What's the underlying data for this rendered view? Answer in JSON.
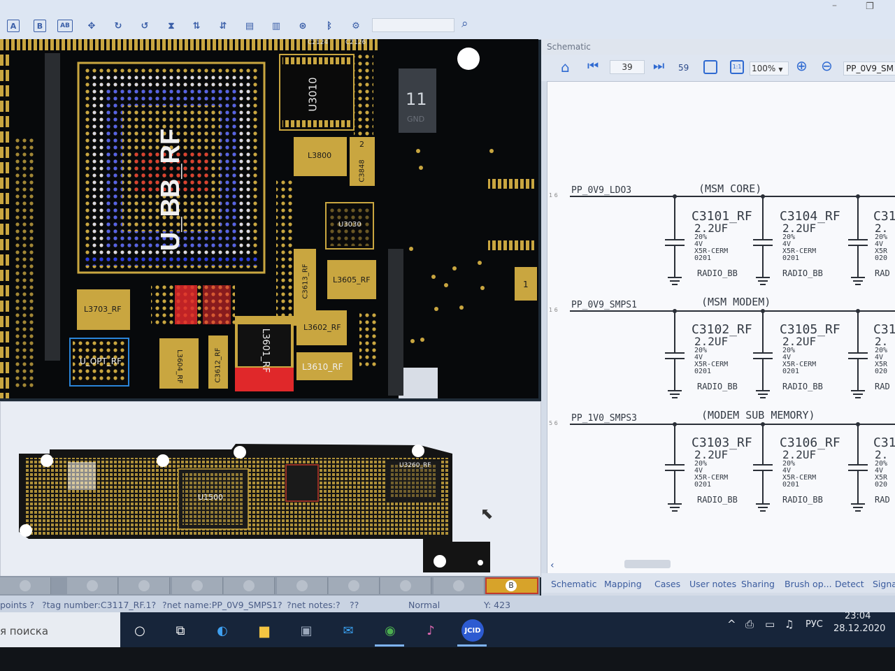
{
  "toolbar": {
    "buttons": [
      "A",
      "B",
      "AB"
    ],
    "label_c2124": "C2124",
    "label_c2126": "C2126"
  },
  "board_top": {
    "chip_main": "U_BB_RF",
    "chip_u3010": "U3010",
    "chip_u3030": "U3030",
    "l3800": "L3800",
    "c3848": "C3848",
    "l3605": "L3605_RF",
    "l3602": "L3602_RF",
    "c3613": "C3613_RF",
    "l3610": "L3610_RF",
    "l3601": "L3601_RF",
    "l3703": "L3703_RF",
    "u_opt": "U_OPT_RF",
    "l3604": "L3604_RF",
    "c3612": "C3612_RF",
    "gnd_number": "11",
    "gnd_label": "GND",
    "pin1": "1",
    "pin2": "2"
  },
  "board_bottom": {
    "chip_u1500": "U1500",
    "chip_u2": "U3260_RF"
  },
  "board_tabs": {
    "active_label": "B"
  },
  "schematic": {
    "header": "Schematic",
    "page_current": "39",
    "page_total": "59",
    "zoom": "100%",
    "net_field": "PP_0V9_SM",
    "rows": [
      {
        "net": "PP_0V9_LDO3",
        "pin_labels": "1 6",
        "title": "(MSM CORE)",
        "caps": [
          {
            "ref": "C3101_RF",
            "val": "2.2UF",
            "tol": "20%",
            "volt": "4V",
            "diel": "X5R-CERM",
            "pkg": "0201",
            "net": "RADIO_BB"
          },
          {
            "ref": "C3104_RF",
            "val": "2.2UF",
            "tol": "20%",
            "volt": "4V",
            "diel": "X5R-CERM",
            "pkg": "0201",
            "net": "RADIO_BB"
          },
          {
            "ref": "C31",
            "val": "2.",
            "tol": "20%",
            "volt": "4V",
            "diel": "X5R",
            "pkg": "020",
            "net": "RAD"
          }
        ]
      },
      {
        "net": "PP_0V9_SMPS1",
        "pin_labels": "1 6",
        "title": "(MSM MODEM)",
        "caps": [
          {
            "ref": "C3102_RF",
            "val": "2.2UF",
            "tol": "20%",
            "volt": "4V",
            "diel": "X5R-CERM",
            "pkg": "0201",
            "net": "RADIO_BB"
          },
          {
            "ref": "C3105_RF",
            "val": "2.2UF",
            "tol": "20%",
            "volt": "4V",
            "diel": "X5R-CERM",
            "pkg": "0201",
            "net": "RADIO_BB"
          },
          {
            "ref": "C31",
            "val": "2.",
            "tol": "20%",
            "volt": "4V",
            "diel": "X5R",
            "pkg": "020",
            "net": "RAD"
          }
        ]
      },
      {
        "net": "PP_1V0_SMPS3",
        "pin_labels": "5 6",
        "title": "(MODEM SUB MEMORY)",
        "caps": [
          {
            "ref": "C3103_RF",
            "val": "2.2UF",
            "tol": "20%",
            "volt": "4V",
            "diel": "X5R-CERM",
            "pkg": "0201",
            "net": "RADIO_BB"
          },
          {
            "ref": "C3106_RF",
            "val": "2.2UF",
            "tol": "20%",
            "volt": "4V",
            "diel": "X5R-CERM",
            "pkg": "0201",
            "net": "RADIO_BB"
          },
          {
            "ref": "C31",
            "val": "2.",
            "tol": "20%",
            "volt": "4V",
            "diel": "X5R",
            "pkg": "020",
            "net": "RAD"
          }
        ]
      }
    ],
    "tabs": [
      "Schematic",
      "Mapping",
      "Cases",
      "User notes",
      "Sharing",
      "Brush op...",
      "Detect",
      "Signa"
    ]
  },
  "status": {
    "points": "points ?",
    "tag": "?tag number:C3117_RF.1?",
    "net_name": "?net name:PP_0V9_SMPS1?",
    "net_notes": "?net notes:?",
    "extra": "??",
    "mode": "Normal",
    "y_coord": "Y: 423"
  },
  "taskbar": {
    "search_text": "я поиска",
    "lang": "РУС",
    "time": "23:04",
    "date": "28.12.2020",
    "jcid": "JCID"
  },
  "colors": {
    "pad_gold": "#c9a640",
    "pin_blue": "#2a3ce6",
    "pin_red": "#e0282a",
    "board_bg": "#07090b",
    "schematic_text": "#333a44"
  }
}
